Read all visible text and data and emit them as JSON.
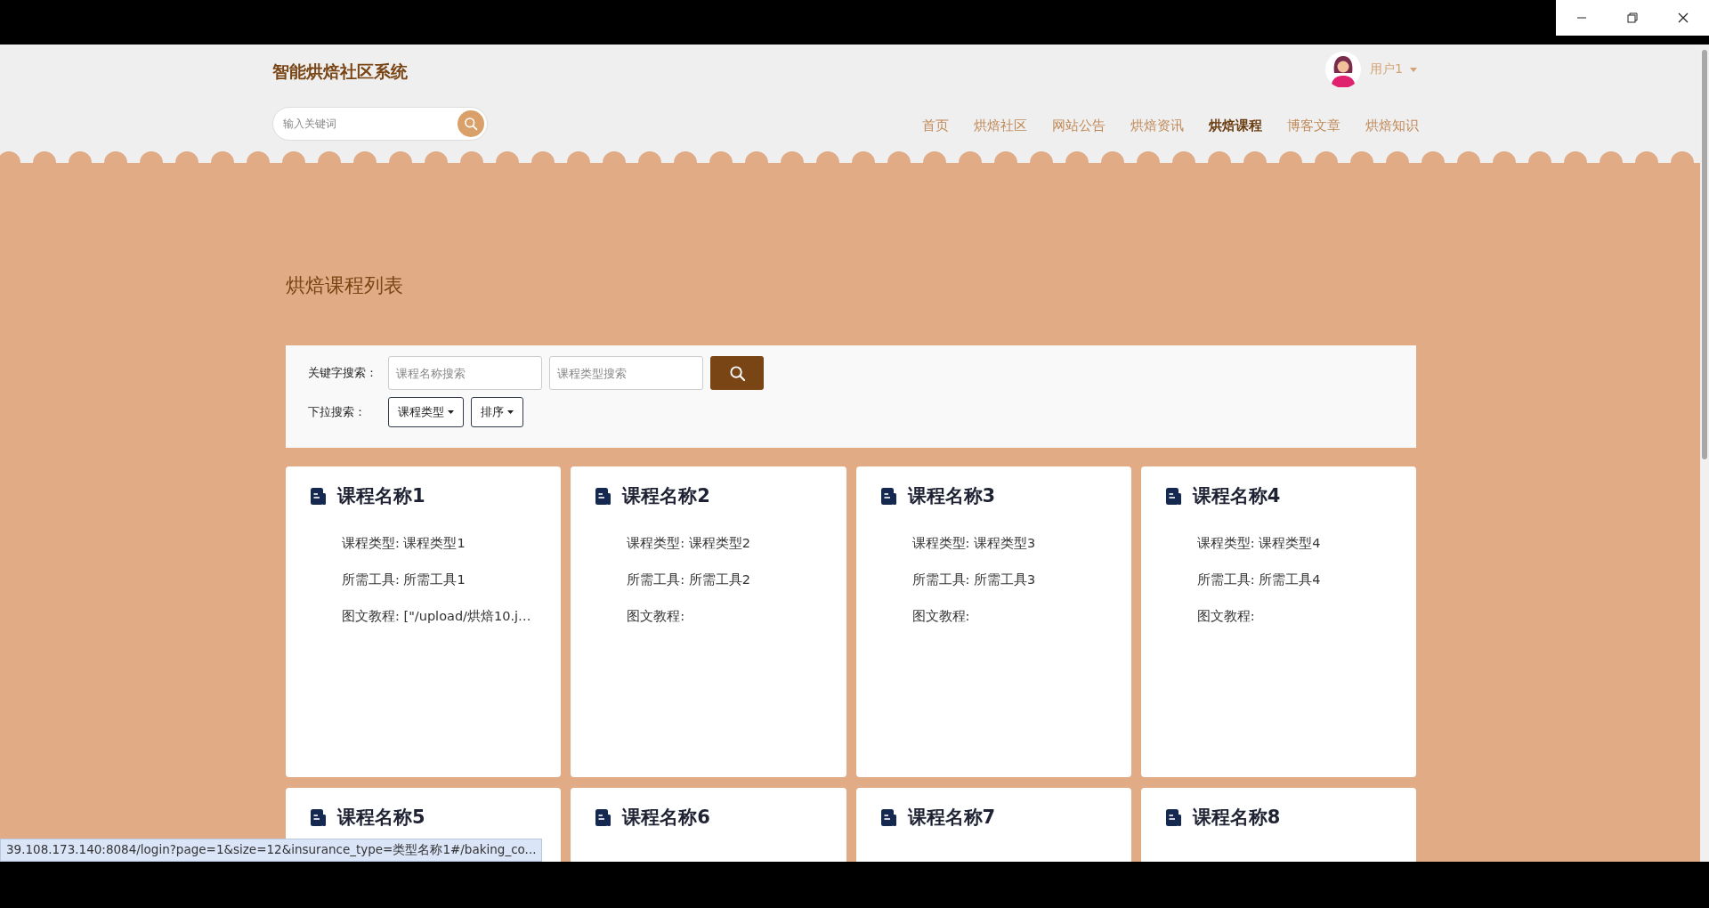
{
  "site": {
    "title": "智能烘焙社区系统"
  },
  "header_search": {
    "placeholder": "输入关键词"
  },
  "user": {
    "name": "用户1"
  },
  "nav": [
    {
      "label": "首页",
      "selected": false
    },
    {
      "label": "烘焙社区",
      "selected": false
    },
    {
      "label": "网站公告",
      "selected": false
    },
    {
      "label": "烘焙资讯",
      "selected": false
    },
    {
      "label": "烘焙课程",
      "selected": true
    },
    {
      "label": "博客文章",
      "selected": false
    },
    {
      "label": "烘焙知识",
      "selected": false
    }
  ],
  "page_title": "烘焙课程列表",
  "filters": {
    "keyword_label": "关键字搜索：",
    "name_field": {
      "placeholder": "课程名称搜索"
    },
    "type_field": {
      "placeholder": "课程类型搜索"
    },
    "dropdown_label": "下拉搜索：",
    "dropdowns": [
      "课程类型",
      "排序"
    ]
  },
  "courses": [
    {
      "title": "课程名称1",
      "fields": [
        "课程类型: 课程类型1",
        "所需工具: 所需工具1",
        "图文教程: [\"/upload/烘焙10.j…"
      ]
    },
    {
      "title": "课程名称2",
      "fields": [
        "课程类型: 课程类型2",
        "所需工具: 所需工具2",
        "图文教程:"
      ]
    },
    {
      "title": "课程名称3",
      "fields": [
        "课程类型: 课程类型3",
        "所需工具: 所需工具3",
        "图文教程:"
      ]
    },
    {
      "title": "课程名称4",
      "fields": [
        "课程类型: 课程类型4",
        "所需工具: 所需工具4",
        "图文教程:"
      ]
    },
    {
      "title": "课程名称5"
    },
    {
      "title": "课程名称6"
    },
    {
      "title": "课程名称7"
    },
    {
      "title": "课程名称8"
    }
  ],
  "status_bar": {
    "url": "39.108.173.140:8084/login?page=1&size=12&insurance_type=类型名称1#/baking_co..."
  }
}
